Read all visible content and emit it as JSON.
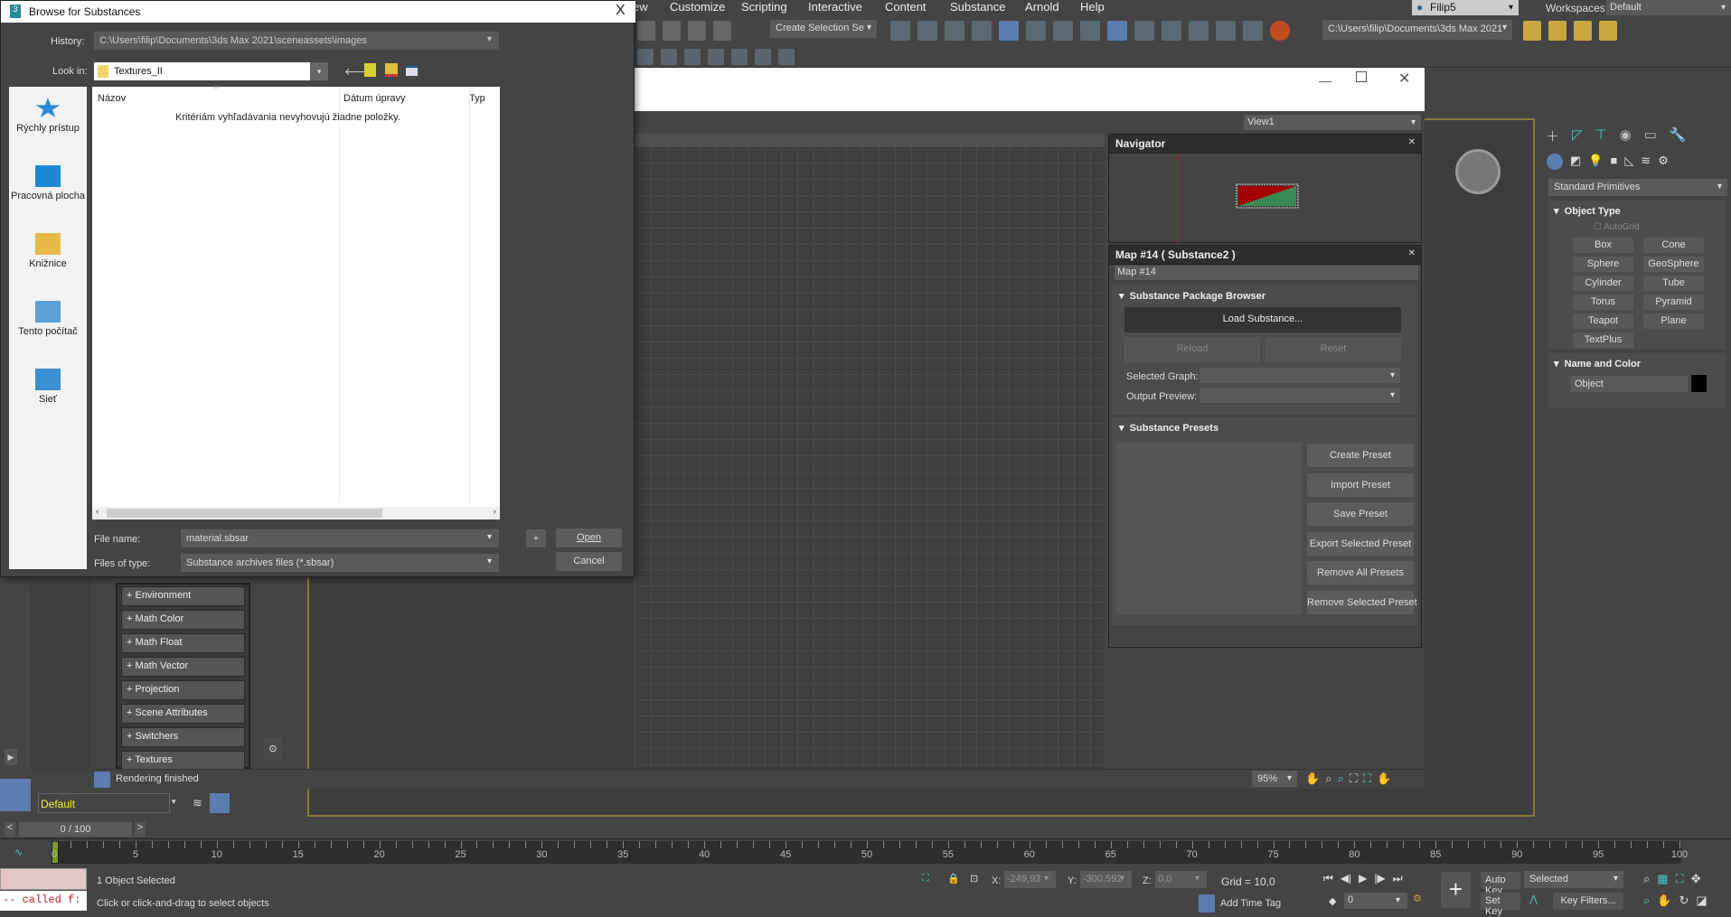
{
  "menubar": {
    "items": [
      "ew",
      "Customize",
      "Scripting",
      "Interactive",
      "Content",
      "Substance",
      "Arnold",
      "Help"
    ],
    "user": "Filip5",
    "workspaces_label": "Workspaces:",
    "workspace": "Default"
  },
  "toolbar": {
    "selection_set": "Create Selection Se",
    "project_path": "C:\\Users\\filip\\Documents\\3ds Max 2021"
  },
  "material_editor": {
    "view_dropdown": "View1",
    "navigator_title": "Navigator",
    "map_title": "Map #14  ( Substance2 )",
    "map_name": "Map #14",
    "package_browser": {
      "title": "Substance Package Browser",
      "load": "Load Substance...",
      "reload": "Reload",
      "reset": "Reset",
      "selected_graph_label": "Selected Graph:",
      "output_preview_label": "Output Preview:"
    },
    "presets": {
      "title": "Substance Presets",
      "buttons": [
        "Create Preset",
        "Import Preset",
        "Save Preset",
        "Export Selected Preset",
        "Remove All Presets",
        "Remove Selected Preset"
      ]
    },
    "node_categories": [
      "+ Environment",
      "+ Math Color",
      "+ Math Float",
      "+ Math Vector",
      "+ Projection",
      "+ Scene Attributes",
      "+ Switchers",
      "+ Textures"
    ],
    "status": "Rendering finished",
    "zoom": "95%",
    "preview_colors": {
      "top": "#a30000",
      "bottom": "#3a8a55"
    }
  },
  "dialog": {
    "title": "Browse for Substances",
    "history_label": "History:",
    "history_value": "C:\\Users\\filip\\Documents\\3ds Max 2021\\sceneassets\\images",
    "lookin_label": "Look in:",
    "lookin_value": "Textures_II",
    "places": [
      "Rýchly prístup",
      "Pracovná plocha",
      "Knižnice",
      "Tento počítač",
      "Sieť"
    ],
    "columns": [
      "Názov",
      "Dátum úpravy",
      "Typ"
    ],
    "empty_message": "Kritériám vyhľadávania nevyhovujú žiadne položky.",
    "filename_label": "File name:",
    "filename_value": "material.sbsar",
    "filetype_label": "Files of type:",
    "filetype_value": "Substance archives files (*.sbsar)",
    "plus": "+",
    "open": "Open",
    "cancel": "Cancel",
    "close": "X"
  },
  "command_panel": {
    "category": "Standard Primitives",
    "object_type_title": "Object Type",
    "autogrid": "AutoGrid",
    "buttons": [
      "Box",
      "Cone",
      "Sphere",
      "GeoSphere",
      "Cylinder",
      "Tube",
      "Torus",
      "Pyramid",
      "Teapot",
      "Plane",
      "TextPlus"
    ],
    "name_color_title": "Name and Color",
    "object_name": "Object",
    "object_color": "#000000"
  },
  "layer": {
    "value": "Default"
  },
  "timeline": {
    "frame": "0 / 100",
    "ticks": [
      0,
      5,
      10,
      15,
      20,
      25,
      30,
      35,
      40,
      45,
      50,
      55,
      60,
      65,
      70,
      75,
      80,
      85,
      90,
      95,
      100
    ],
    "current_frame": 0
  },
  "statusbar": {
    "maxscript": "-- called f:",
    "selection": "1 Object Selected",
    "prompt": "Click or click-and-drag to select objects",
    "x_label": "X:",
    "x": "-249,93",
    "y_label": "Y:",
    "y": "-300,592",
    "z_label": "Z:",
    "z": "0,0",
    "grid": "Grid = 10,0",
    "add_time_tag": "Add Time Tag",
    "auto_key": "Auto Key",
    "set_key": "Set Key",
    "key_mode": "Selected",
    "key_filters": "Key Filters...",
    "frame_field": "0"
  }
}
